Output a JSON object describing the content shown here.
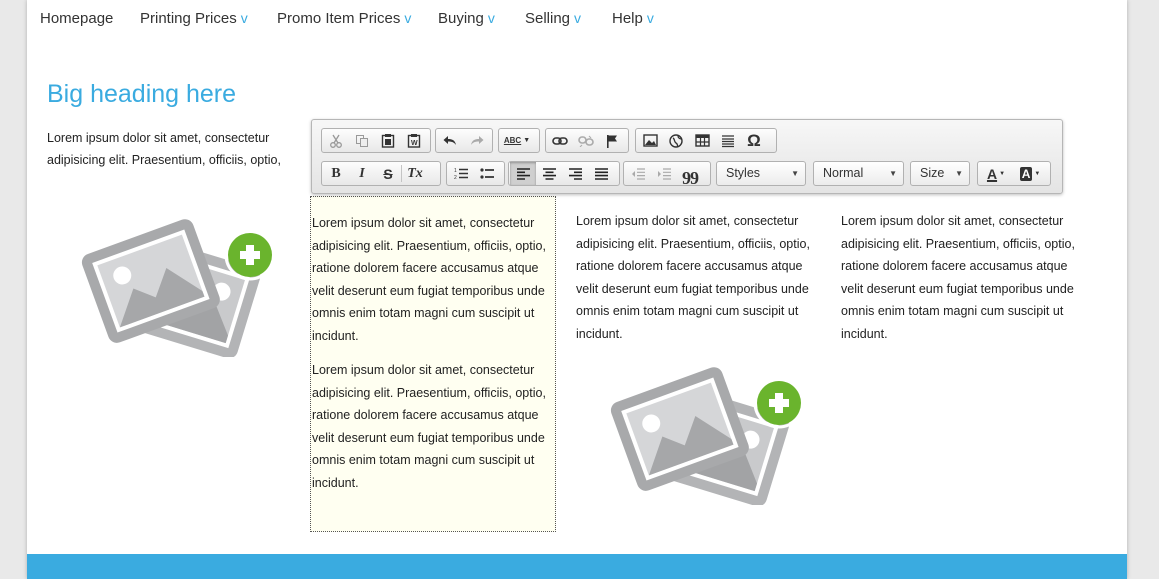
{
  "nav": {
    "items": [
      {
        "label": "Homepage",
        "caret": ""
      },
      {
        "label": "Printing Prices",
        "caret": "v"
      },
      {
        "label": "Promo Item Prices",
        "caret": "v"
      },
      {
        "label": "Buying",
        "caret": "v"
      },
      {
        "label": "Selling",
        "caret": "v"
      },
      {
        "label": "Help",
        "caret": "v"
      }
    ]
  },
  "content": {
    "heading": "Big heading here",
    "intro": "Lorem ipsum dolor sit amet, consectetur adipisicing elit. Praesentium, officiis, optio, ratione dolorem facere accusamus atque velit deserunt eum fugiat temporibus unde omnis enim totam magni cum suscipit ut incidunt.",
    "editable_paragraphs": [
      "Lorem ipsum dolor sit amet, consectetur adipisicing elit. Praesentium, officiis, optio, ratione dolorem facere accusamus atque velit deserunt eum fugiat temporibus unde omnis enim totam magni cum suscipit ut incidunt.",
      "Lorem ipsum dolor sit amet, consectetur adipisicing elit. Praesentium, officiis, optio, ratione dolorem facere accusamus atque velit deserunt eum fugiat temporibus unde omnis enim totam magni cum suscipit ut incidunt."
    ],
    "column2_text": "Lorem ipsum dolor sit amet, consectetur adipisicing elit. Praesentium, officiis, optio, ratione dolorem facere accusamus atque velit deserunt eum fugiat temporibus unde omnis enim totam magni cum suscipit ut incidunt.",
    "column3_text": "Lorem ipsum dolor sit amet, consectetur adipisicing elit. Praesentium, officiis, optio, ratione dolorem facere accusamus atque velit deserunt eum fugiat temporibus unde omnis enim totam magni cum suscipit ut incidunt."
  },
  "toolbar": {
    "row1": {
      "clipboard": [
        "cut-icon",
        "copy-icon",
        "paste-icon",
        "paste-from-word-icon"
      ],
      "history": [
        "undo-icon",
        "redo-icon"
      ],
      "spellcheck": {
        "icon": "spellcheck-icon",
        "label": "ABC"
      },
      "links": [
        "link-icon",
        "unlink-icon",
        "anchor-flag-icon"
      ],
      "insert": [
        "image-icon",
        "globe-icon",
        "table-icon",
        "horizontal-rule-icon",
        "special-char-icon"
      ],
      "special_char_glyph": "Ω"
    },
    "row2": {
      "basic": {
        "bold": "B",
        "italic": "I",
        "strike": "S",
        "remove_format": "Tx"
      },
      "lists": [
        "numbered-list-icon",
        "bulleted-list-icon"
      ],
      "align": [
        "align-left-icon",
        "align-center-icon",
        "align-right-icon",
        "align-justify-icon"
      ],
      "indent": [
        "outdent-icon",
        "indent-icon",
        "blockquote-icon"
      ],
      "blockquote_glyph": "99",
      "styles_label": "Styles",
      "format_label": "Normal",
      "size_label": "Size",
      "text_color_label": "A",
      "bg_color_label": "A"
    }
  },
  "colors": {
    "accent": "#3aabe0",
    "plus": "#6ab42d",
    "editable_bg": "#fffff1"
  }
}
